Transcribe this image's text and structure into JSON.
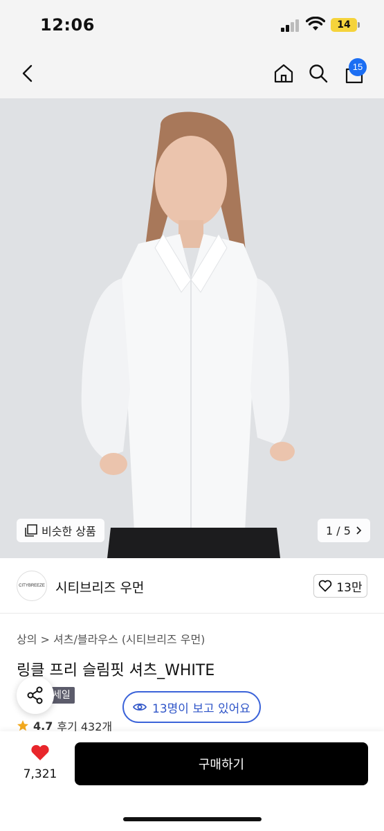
{
  "status": {
    "time": "12:06",
    "battery": "14"
  },
  "nav": {
    "cart_count": "15"
  },
  "hero": {
    "similar_label": "비슷한 상품",
    "pager": "1 / 5"
  },
  "brand": {
    "logo_text": "CITYBREEZE",
    "name": "시티브리즈 우먼",
    "likes": "13만"
  },
  "product": {
    "breadcrumb": "상의  >  셔츠/블라우스 (시티브리즈 우먼)",
    "title": "링클 프리 슬림핏 셔츠_WHITE",
    "badge": "세일",
    "viewers": "13명이 보고 있어요",
    "rating": "4.7",
    "reviews": "후기 432개"
  },
  "bottom": {
    "wish_count": "7,321",
    "buy_label": "구매하기"
  },
  "colors": {
    "accent_blue": "#3b63d9",
    "badge_blue": "#1b6ef3",
    "heart_red": "#e8262b"
  }
}
